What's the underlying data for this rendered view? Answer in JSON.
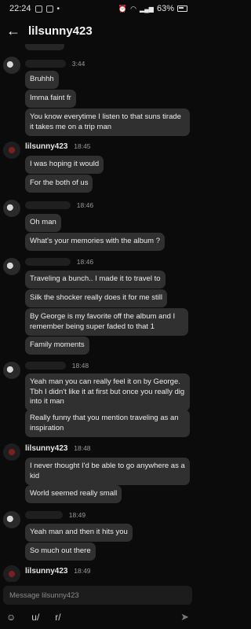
{
  "status_bar": {
    "time": "22:24",
    "battery": "63%"
  },
  "header": {
    "title": "lilsunny423"
  },
  "messages": {
    "g1": {
      "time": "3:44",
      "b1": "Bruhhh",
      "b2": "Imma faint fr",
      "b3": "You know everytime I listen to that suns tirade it takes me on a trip man"
    },
    "g2": {
      "sender": "lilsunny423",
      "time": "18:45",
      "b1": "I was hoping it would",
      "b2": "For the both of us"
    },
    "g3": {
      "time": "18:46",
      "b1": "Oh man",
      "b2": "What's your memories with the album ?"
    },
    "g4": {
      "time": "18:46",
      "b1": "Traveling a bunch.. I made it to travel to",
      "b2": "Silk the shocker really does it for me still",
      "b3": "By George is my favorite off the album and I remember being super faded to that 1",
      "b4": "Family moments"
    },
    "g5": {
      "time": "18:48",
      "b1": "Yeah man you can really feel it on by George. Tbh I didn't like it at first but once you really dig into it man",
      "b2": "Really funny that you mention traveling as an inspiration"
    },
    "g6": {
      "sender": "lilsunny423",
      "time": "18:48",
      "b1": "I never thought I'd be able to go anywhere as a kid",
      "b2": "World seemed really small"
    },
    "g7": {
      "time": "18:49",
      "b1": "Yeah man and then it hits you",
      "b2": "So much out there"
    },
    "g8": {
      "sender": "lilsunny423",
      "time": "18:49"
    }
  },
  "composer": {
    "placeholder": "Message lilsunny423"
  },
  "toolbar": {
    "user_prefix": "u/",
    "subreddit_prefix": "r/"
  }
}
